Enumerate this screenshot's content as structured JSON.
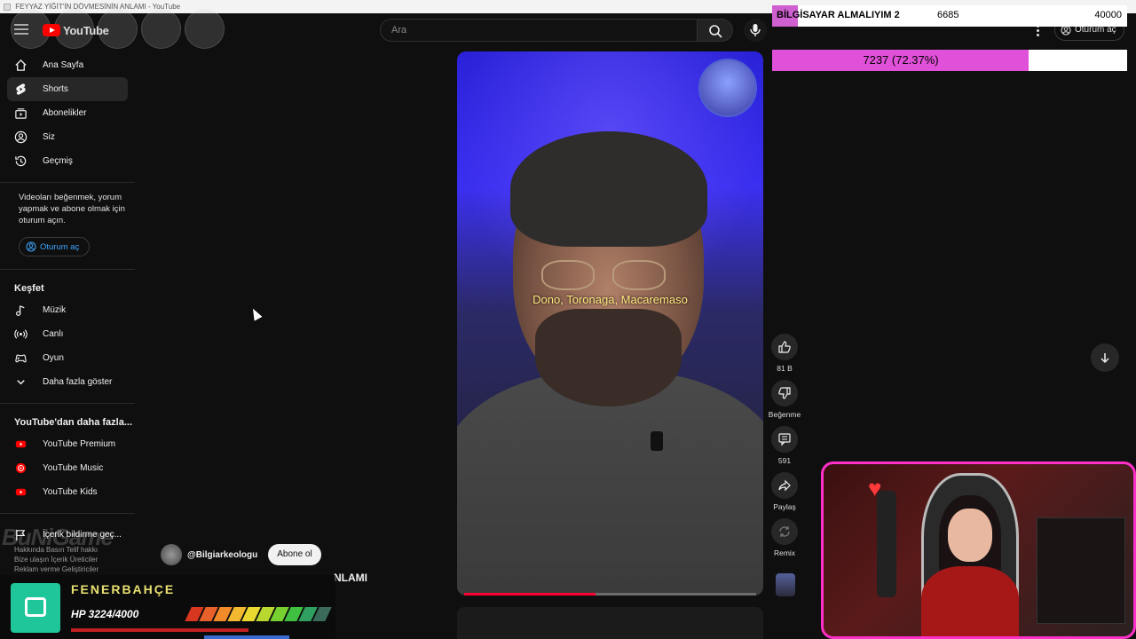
{
  "window": {
    "title": "FEYYAZ YİĞİT'İN DÖVMESİNİN ANLAMI - YouTube"
  },
  "masthead": {
    "logo_text": "YouTube",
    "search_placeholder": "Ara",
    "signin_label": "Oturum aç"
  },
  "sidebar": {
    "main_items": [
      {
        "label": "Ana Sayfa",
        "icon": "home-icon"
      },
      {
        "label": "Shorts",
        "icon": "shorts-icon",
        "active": true
      },
      {
        "label": "Abonelikler",
        "icon": "subscriptions-icon"
      },
      {
        "label": "Siz",
        "icon": "user-icon"
      },
      {
        "label": "Geçmiş",
        "icon": "history-icon"
      }
    ],
    "signin_prompt": "Videoları beğenmek, yorum yapmak ve abone olmak için oturum açın.",
    "signin_button": "Oturum aç",
    "explore_title": "Keşfet",
    "explore_items": [
      {
        "label": "Müzik",
        "icon": "music-icon"
      },
      {
        "label": "Canlı",
        "icon": "live-icon"
      },
      {
        "label": "Oyun",
        "icon": "gaming-icon"
      },
      {
        "label": "Daha fazla göster",
        "icon": "chevron-down-icon"
      }
    ],
    "more_title": "YouTube'dan daha fazla...",
    "more_items": [
      {
        "label": "YouTube Premium",
        "icon": "yt-premium-icon"
      },
      {
        "label": "YouTube Music",
        "icon": "yt-music-icon"
      },
      {
        "label": "YouTube Kids",
        "icon": "yt-kids-icon"
      }
    ],
    "report_item": "İçerik bildirme geç...",
    "footer_line1": "Hakkında  Basın  Telif hakkı",
    "footer_line2": "Bize ulaşın  İçerik Üreticiler",
    "footer_line3": "Reklam verme  Geliştiriciler"
  },
  "overlay_brand": "BuNiGame",
  "video": {
    "subtitle": "Dono, Toronaga, Macaremaso",
    "channel": "@Bilgiarkeologu",
    "subscribe_label": "Abone ol",
    "title_fragment": "NLAMI",
    "progress": 0.45
  },
  "actions": {
    "like_count": "81 B",
    "dislike_label": "Beğenme",
    "comment_count": "591",
    "share_label": "Paylaş",
    "remix_label": "Remix"
  },
  "donation_goal": {
    "title": "BİLGİSAYAR ALMALIYIM 2",
    "current": "6685",
    "target": "40000",
    "progress_text": "7237 (72.37%)",
    "progress": 0.7237,
    "fill_color": "#e050d8"
  },
  "game": {
    "team": "FENERBAHÇE",
    "hp_text": "HP 3224/4000",
    "segment_colors": [
      "#d8361e",
      "#e8602a",
      "#f08a2a",
      "#f2b830",
      "#e8d830",
      "#b8d830",
      "#78d030",
      "#40c040",
      "#2fa060",
      "#3a6a5a"
    ]
  },
  "colors": {
    "background": "#0f0f0f",
    "accent_link": "#3ea6ff",
    "yt_red": "#ff0000",
    "webcam_border": "#ff2fc9"
  }
}
